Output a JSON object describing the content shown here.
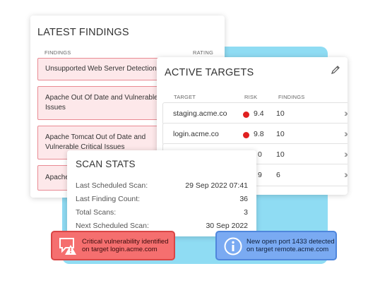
{
  "latest_findings": {
    "title": "LATEST FINDINGS",
    "col_findings": "FINDINGS",
    "col_rating": "RATING",
    "items": [
      "Unsupported Web Server Detection",
      "Apache Out Of Date and Vulnerable Issues",
      "Apache Tomcat Out of Date and Vulnerable Critical Issues",
      "Apache"
    ]
  },
  "active_targets": {
    "title": "ACTIVE TARGETS",
    "edit_icon": "pencil-icon",
    "col_target": "TARGET",
    "col_risk": "RISK",
    "col_findings": "FINDINGS",
    "risk_color": "#e02020",
    "rows": [
      {
        "target": "staging.acme.co",
        "risk": "9.4",
        "findings": "10"
      },
      {
        "target": "login.acme.co",
        "risk": "9.8",
        "findings": "10"
      },
      {
        "target": "",
        "risk": "0",
        "findings": "10"
      },
      {
        "target": "",
        "risk": "9",
        "findings": "6"
      }
    ]
  },
  "scan_stats": {
    "title": "SCAN STATS",
    "rows": [
      {
        "label": "Last Scheduled Scan:",
        "value": "29 Sep 2022 07:41"
      },
      {
        "label": "Last Finding Count:",
        "value": "36"
      },
      {
        "label": "Total Scans:",
        "value": "3"
      },
      {
        "label": "Next Scheduled Scan:",
        "value": "30 Sep 2022"
      }
    ]
  },
  "alerts": {
    "critical": {
      "text": "Critical vulnerability identified on target login.acme.com",
      "color": "#f56f6f",
      "icon": "warning-chat-icon"
    },
    "info": {
      "text": "New open port 1433 detected on target remote.acme.com",
      "color": "#7aaaf2",
      "icon": "info-icon"
    }
  }
}
